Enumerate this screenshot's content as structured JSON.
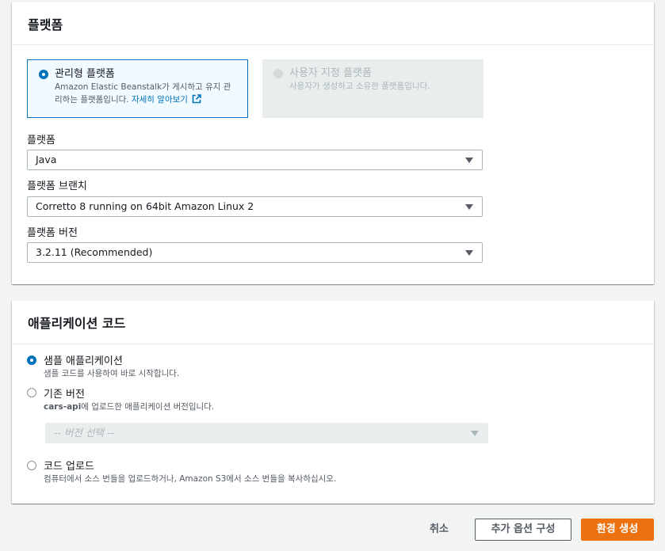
{
  "platform_section": {
    "title": "플랫폼",
    "managed": {
      "title": "관리형 플랫폼",
      "desc_line1": "Amazon Elastic Beanstalk가 게시하고 유지 관",
      "desc_line2": "리하는 플랫폼입니다.",
      "link": "자세히 알아보기"
    },
    "custom": {
      "title": "사용자 지정 플랫폼",
      "desc": "사용자가 생성하고 소유한 플랫폼입니다."
    },
    "platform_label": "플랫폼",
    "platform_value": "Java",
    "branch_label": "플랫폼 브랜치",
    "branch_value": "Corretto 8 running on 64bit Amazon Linux 2",
    "version_label": "플랫폼 버전",
    "version_value": "3.2.11 (Recommended)"
  },
  "code_section": {
    "title": "애플리케이션 코드",
    "sample": {
      "title": "샘플 애플리케이션",
      "desc": "샘플 코드를 사용하여 바로 시작합니다."
    },
    "existing": {
      "title": "기존 버전",
      "desc_bold": "cars-api",
      "desc_rest": "에 업로드한 애플리케이션 버전입니다.",
      "select_placeholder": "-- 버전 선택 --"
    },
    "upload": {
      "title": "코드 업로드",
      "desc": "컴퓨터에서 소스 번들을 업로드하거나, Amazon S3에서 소스 번들을 복사하십시오."
    }
  },
  "footer": {
    "cancel": "취소",
    "more_options": "추가 옵션 구성",
    "create": "환경 생성"
  },
  "colors": {
    "accent": "#0073bb",
    "primary_button": "#ec7211"
  }
}
